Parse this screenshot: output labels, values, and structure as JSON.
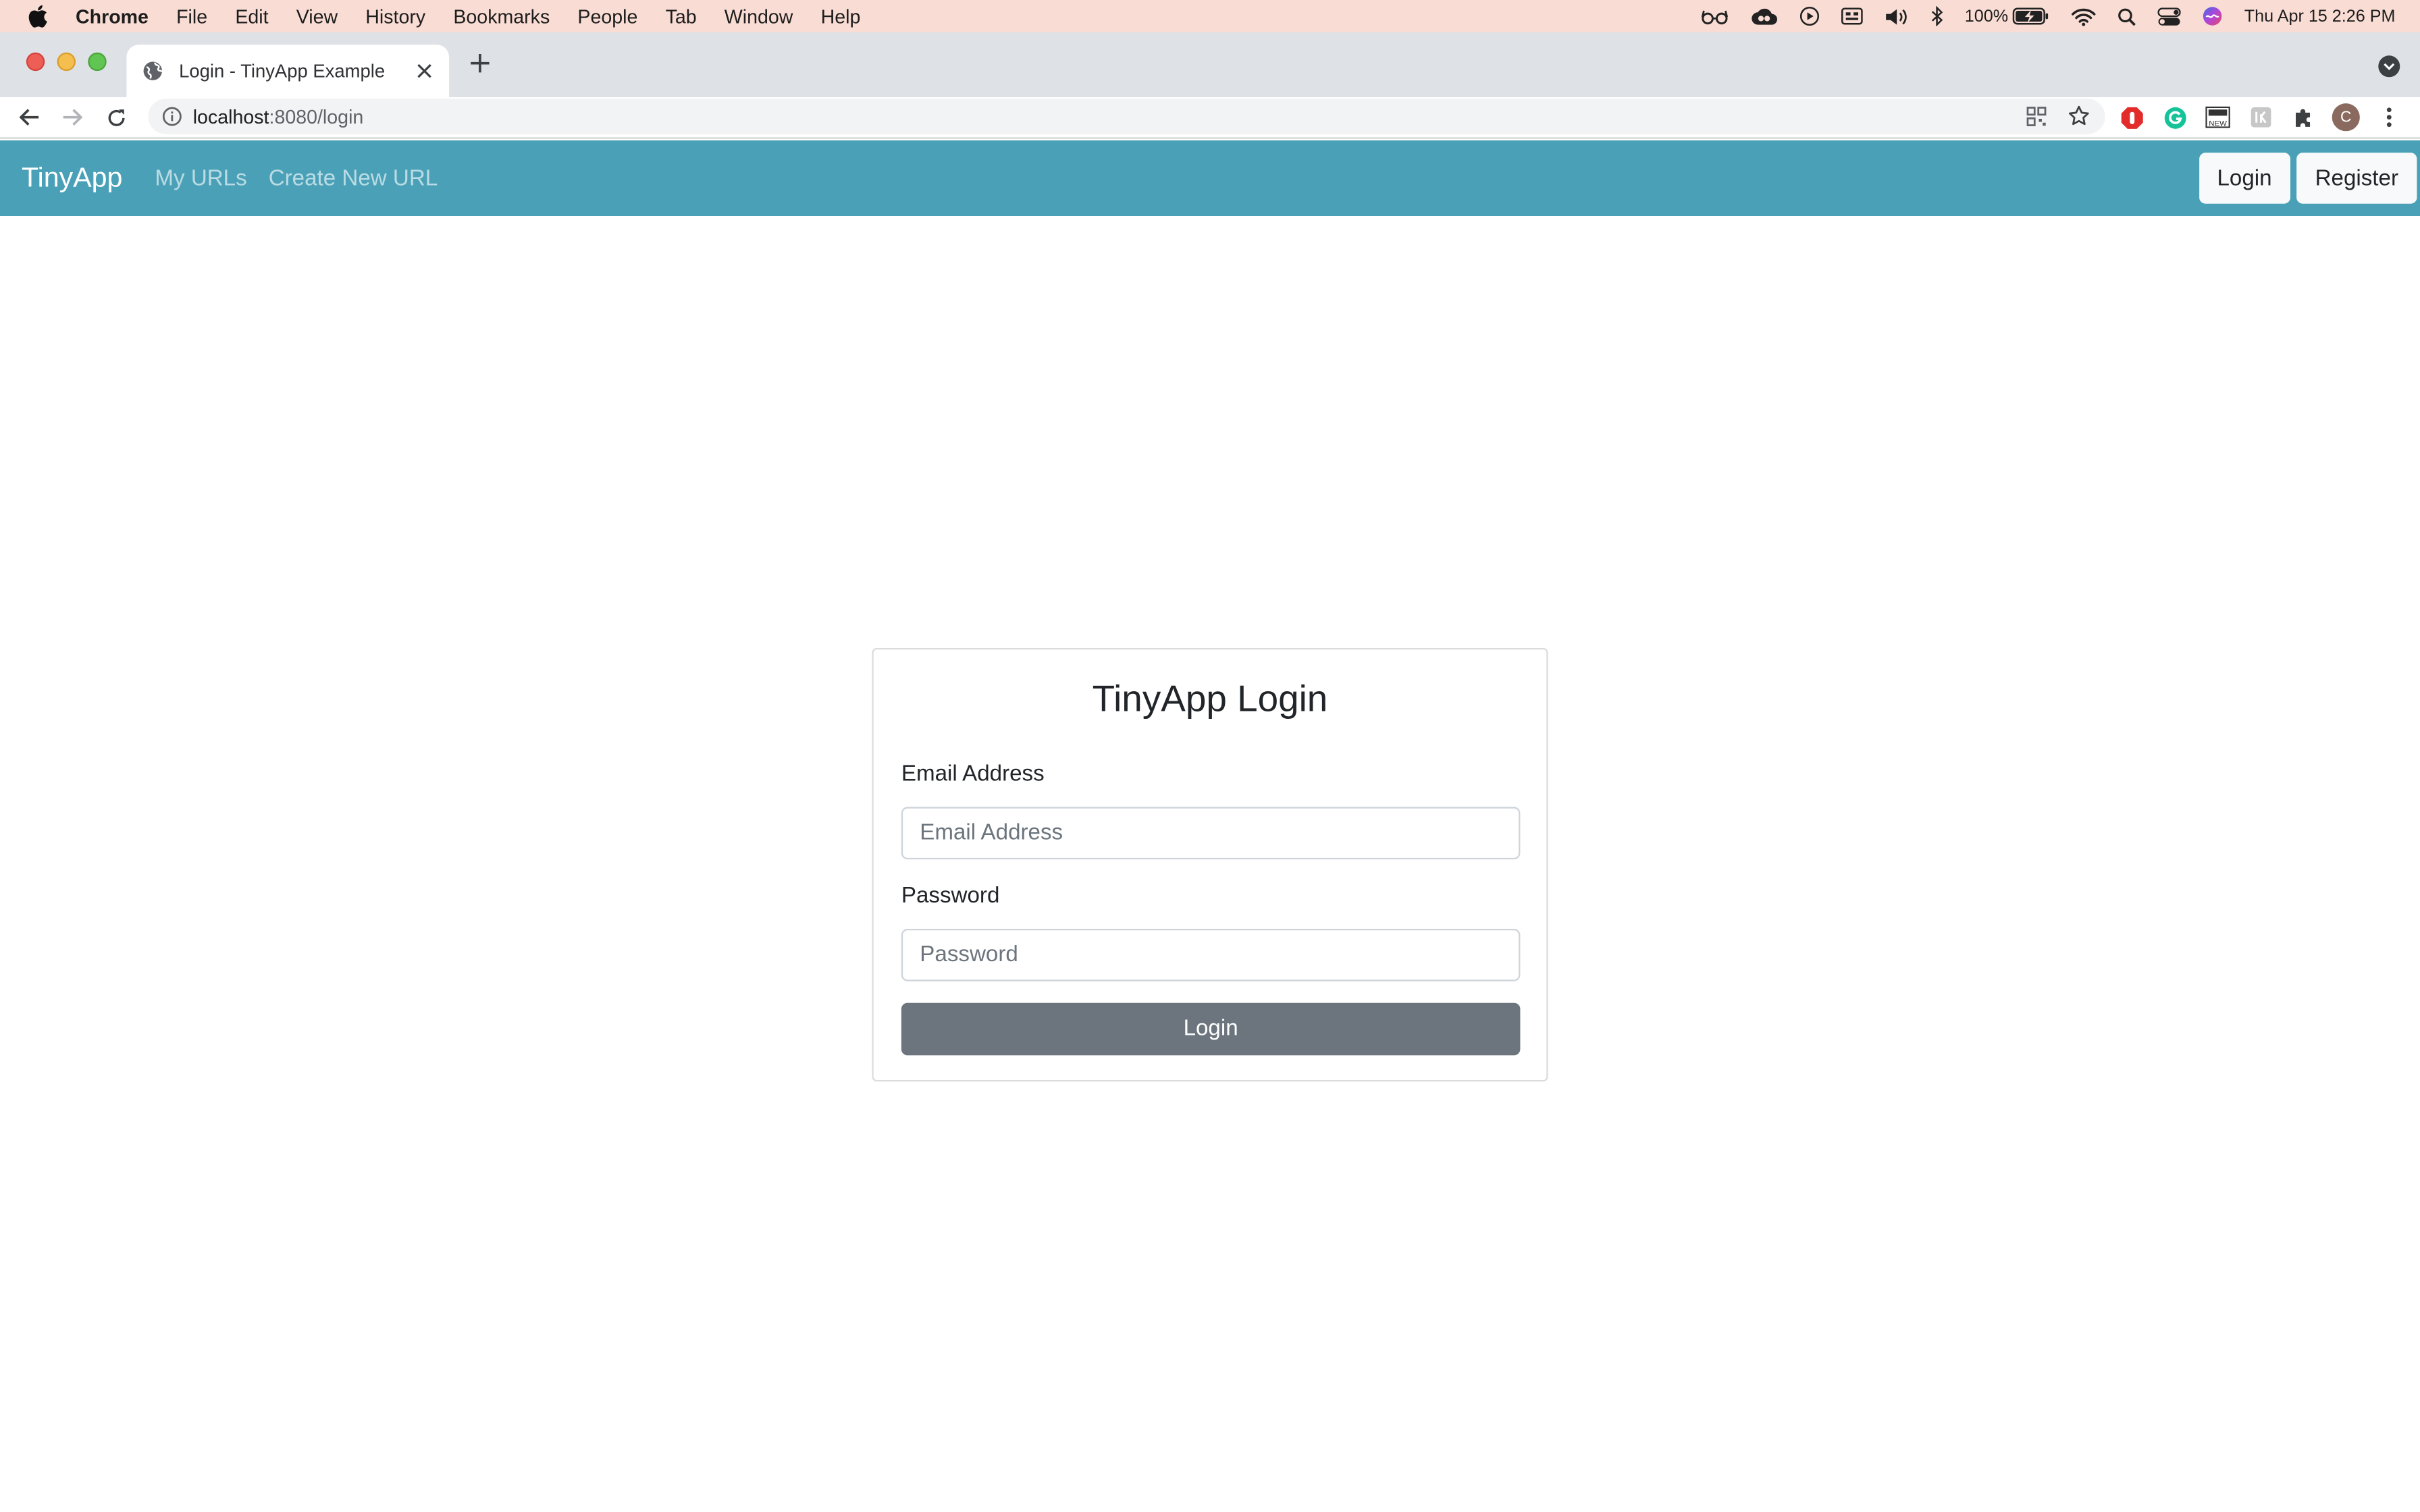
{
  "menubar": {
    "app_name": "Chrome",
    "items": [
      "File",
      "Edit",
      "View",
      "History",
      "Bookmarks",
      "People",
      "Tab",
      "Window",
      "Help"
    ],
    "battery": "100%",
    "clock": "Thu Apr 15  2:26 PM"
  },
  "browser": {
    "tab_title": "Login - TinyApp Example",
    "url_host": "localhost",
    "url_rest": ":8080/login",
    "profile_initial": "C"
  },
  "navbar": {
    "brand": "TinyApp",
    "links": [
      "My URLs",
      "Create New URL"
    ],
    "login_label": "Login",
    "register_label": "Register",
    "color": "#4aa1b7"
  },
  "login_form": {
    "heading": "TinyApp Login",
    "email_label": "Email Address",
    "email_placeholder": "Email Address",
    "password_label": "Password",
    "password_placeholder": "Password",
    "submit_label": "Login"
  }
}
